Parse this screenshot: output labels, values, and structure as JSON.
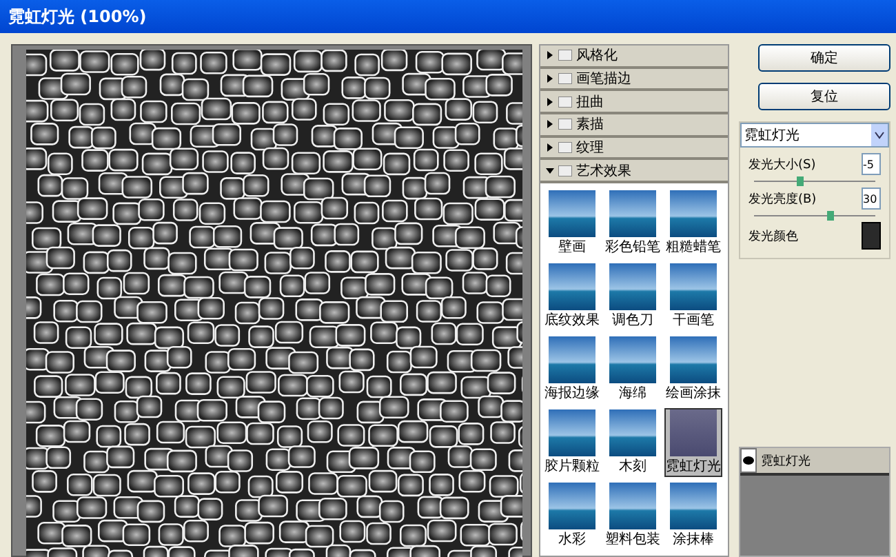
{
  "window": {
    "title": "霓虹灯光 (100%)"
  },
  "categories": [
    {
      "label": "风格化",
      "expanded": false
    },
    {
      "label": "画笔描边",
      "expanded": false
    },
    {
      "label": "扭曲",
      "expanded": false
    },
    {
      "label": "素描",
      "expanded": false
    },
    {
      "label": "纹理",
      "expanded": false
    },
    {
      "label": "艺术效果",
      "expanded": true
    }
  ],
  "filters": [
    {
      "label": "壁画",
      "selected": false
    },
    {
      "label": "彩色铅笔",
      "selected": false
    },
    {
      "label": "粗糙蜡笔",
      "selected": false
    },
    {
      "label": "底纹效果",
      "selected": false
    },
    {
      "label": "调色刀",
      "selected": false
    },
    {
      "label": "干画笔",
      "selected": false
    },
    {
      "label": "海报边缘",
      "selected": false
    },
    {
      "label": "海绵",
      "selected": false
    },
    {
      "label": "绘画涂抹",
      "selected": false
    },
    {
      "label": "胶片颗粒",
      "selected": false
    },
    {
      "label": "木刻",
      "selected": false
    },
    {
      "label": "霓虹灯光",
      "selected": true
    },
    {
      "label": "水彩",
      "selected": false
    },
    {
      "label": "塑料包装",
      "selected": false
    },
    {
      "label": "涂抹棒",
      "selected": false
    }
  ],
  "buttons": [
    "确定",
    "复位"
  ],
  "filter_select": {
    "value": "霓虹灯光"
  },
  "params": [
    {
      "kind": "slider",
      "label": "发光大小(S)",
      "value": "-5",
      "level": 0.37
    },
    {
      "kind": "slider",
      "label": "发光亮度(B)",
      "value": "30",
      "level": 0.62
    },
    {
      "kind": "color",
      "label": "发光颜色",
      "color": "#2a2a2a"
    }
  ],
  "layers": [
    {
      "label": "霓虹灯光",
      "visible": true
    }
  ]
}
